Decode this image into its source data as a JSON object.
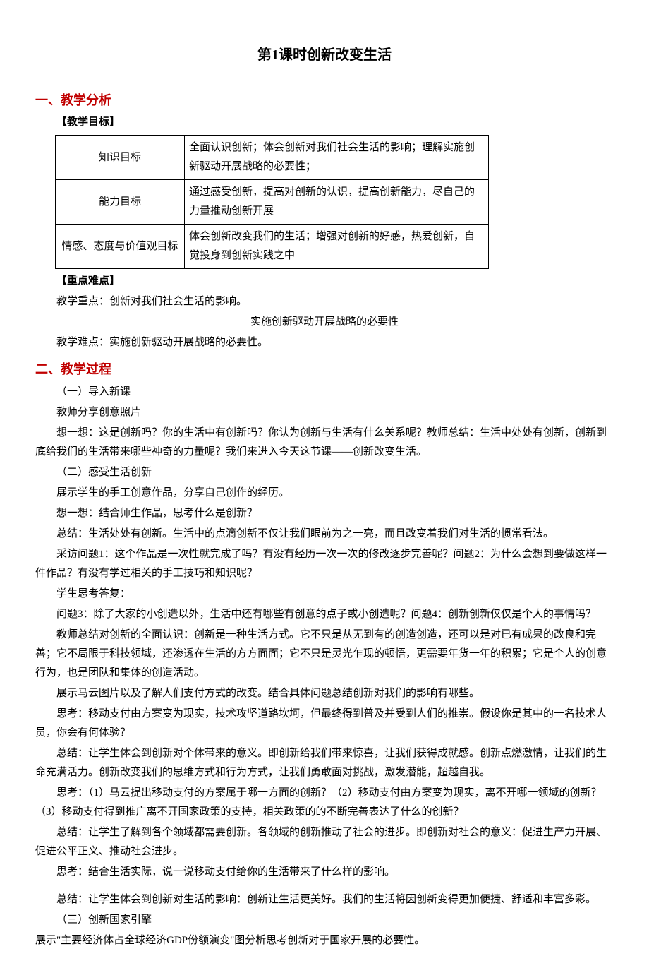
{
  "title": "第1课时创新改变生活",
  "section1": {
    "heading": "一、教学分析",
    "objectives_label": "【教学目标】",
    "table": {
      "r1c1": "知识目标",
      "r1c2": "全面认识创新；体会创新对我们社会生活的影响；理解实施创新驱动开展战略的必要性；",
      "r2c1": "能力目标",
      "r2c2": "通过感受创新，提高对创新的认识，提高创新能力，尽自己的力量推动创新开展",
      "r3c1": "情感、态度与价值观目标",
      "r3c2": "体会创新改变我们的生活；增强对创新的好感，热爱创新，自觉投身到创新实践之中"
    },
    "keypoints_label": "【重点难点】",
    "keypoint_line": "教学重点：创新对我们社会生活的影响。",
    "center_line": "实施创新驱动开展战略的必要性",
    "difficulty_line": "教学难点：实施创新驱动开展战略的必要性。"
  },
  "section2": {
    "heading": "二、教学过程",
    "p1": "（一）导入新课",
    "p2": "教师分享创意照片",
    "p3": "想一想：这是创新吗？你的生活中有创新吗？你认为创新与生活有什么关系呢？教师总结：生活中处处有创新，创新到底给我们的生活带来哪些神奇的力量呢？我们来进入今天这节课——创新改变生活。",
    "p4": "（二）感受生活创新",
    "p5": "展示学生的手工创意作品，分享自己创作的经历。",
    "p6": "想一想：结合师生作品，思考什么是创新？",
    "p7": "总结：生活处处有创新。生活中的点滴创新不仅让我们眼前为之一亮，而且改变着我们对生活的惯常看法。",
    "p8": "采访问题1：这个作品是一次性就完成了吗？有没有经历一次一次的修改逐步完善呢？问题2：为什么会想到要做这样一件作品？有没有学过相关的手工技巧和知识呢？",
    "p9": "学生思考答复：",
    "p10": "问题3：除了大家的小创造以外，生活中还有哪些有创意的点子或小创造呢？问题4：创新创新仅仅是个人的事情吗？",
    "p11": "教师总结对创新的全面认识：创新是一种生活方式。它不只是从无到有的创造创造，还可以是对已有成果的改良和完善；它不局限于科技领域，还渗透在生活的方方面面；它不只是灵光乍现的顿悟，更需要年货一年的积累；它是个人的创意行为，也是团队和集体的创造活动。",
    "p12": "展示马云图片以及了解人们支付方式的改变。结合具体问题总结创新对我们的影响有哪些。",
    "p13": "思考：移动支付由方案变为现实，技术攻坚道路坎坷，但最终得到普及并受到人们的推崇。假设你是其中的一名技术人员，你会有何体验？",
    "p14": "总结：让学生体会到创新对个体带来的意义。即创新给我们带来惊喜，让我们获得成就感。创新点燃激情，让我们的生命充满活力。创新改变我们的思维方式和行为方式，让我们勇敢面对挑战，激发潜能，超越自我。",
    "p15": "思考：（1）马云提出移动支付的方案属于哪一方面的创新？（2）移动支付由方案变为现实，离不开哪一领域的创新？（3）移动支付得到推广离不开国家政策的支持，相关政策的的不断完善表达了什么的创新？",
    "p16": "总结：让学生了解到各个领域都需要创新。各领域的创新推动了社会的进步。即创新对社会的意义：促进生产力开展、促进公平正义、推动社会进步。",
    "p17": "思考：结合生活实际，说一说移动支付给你的生活带来了什么样的影响。",
    "p18": "总结：让学生体会到创新对生活的影响：创新让生活更美好。我们的生活将因创新变得更加便捷、舒适和丰富多彩。",
    "p19": "（三）创新国家引擎",
    "p20": "展示\"主要经济体占全球经济GDP份额演变\"图分析思考创新对于国家开展的必要性。"
  }
}
